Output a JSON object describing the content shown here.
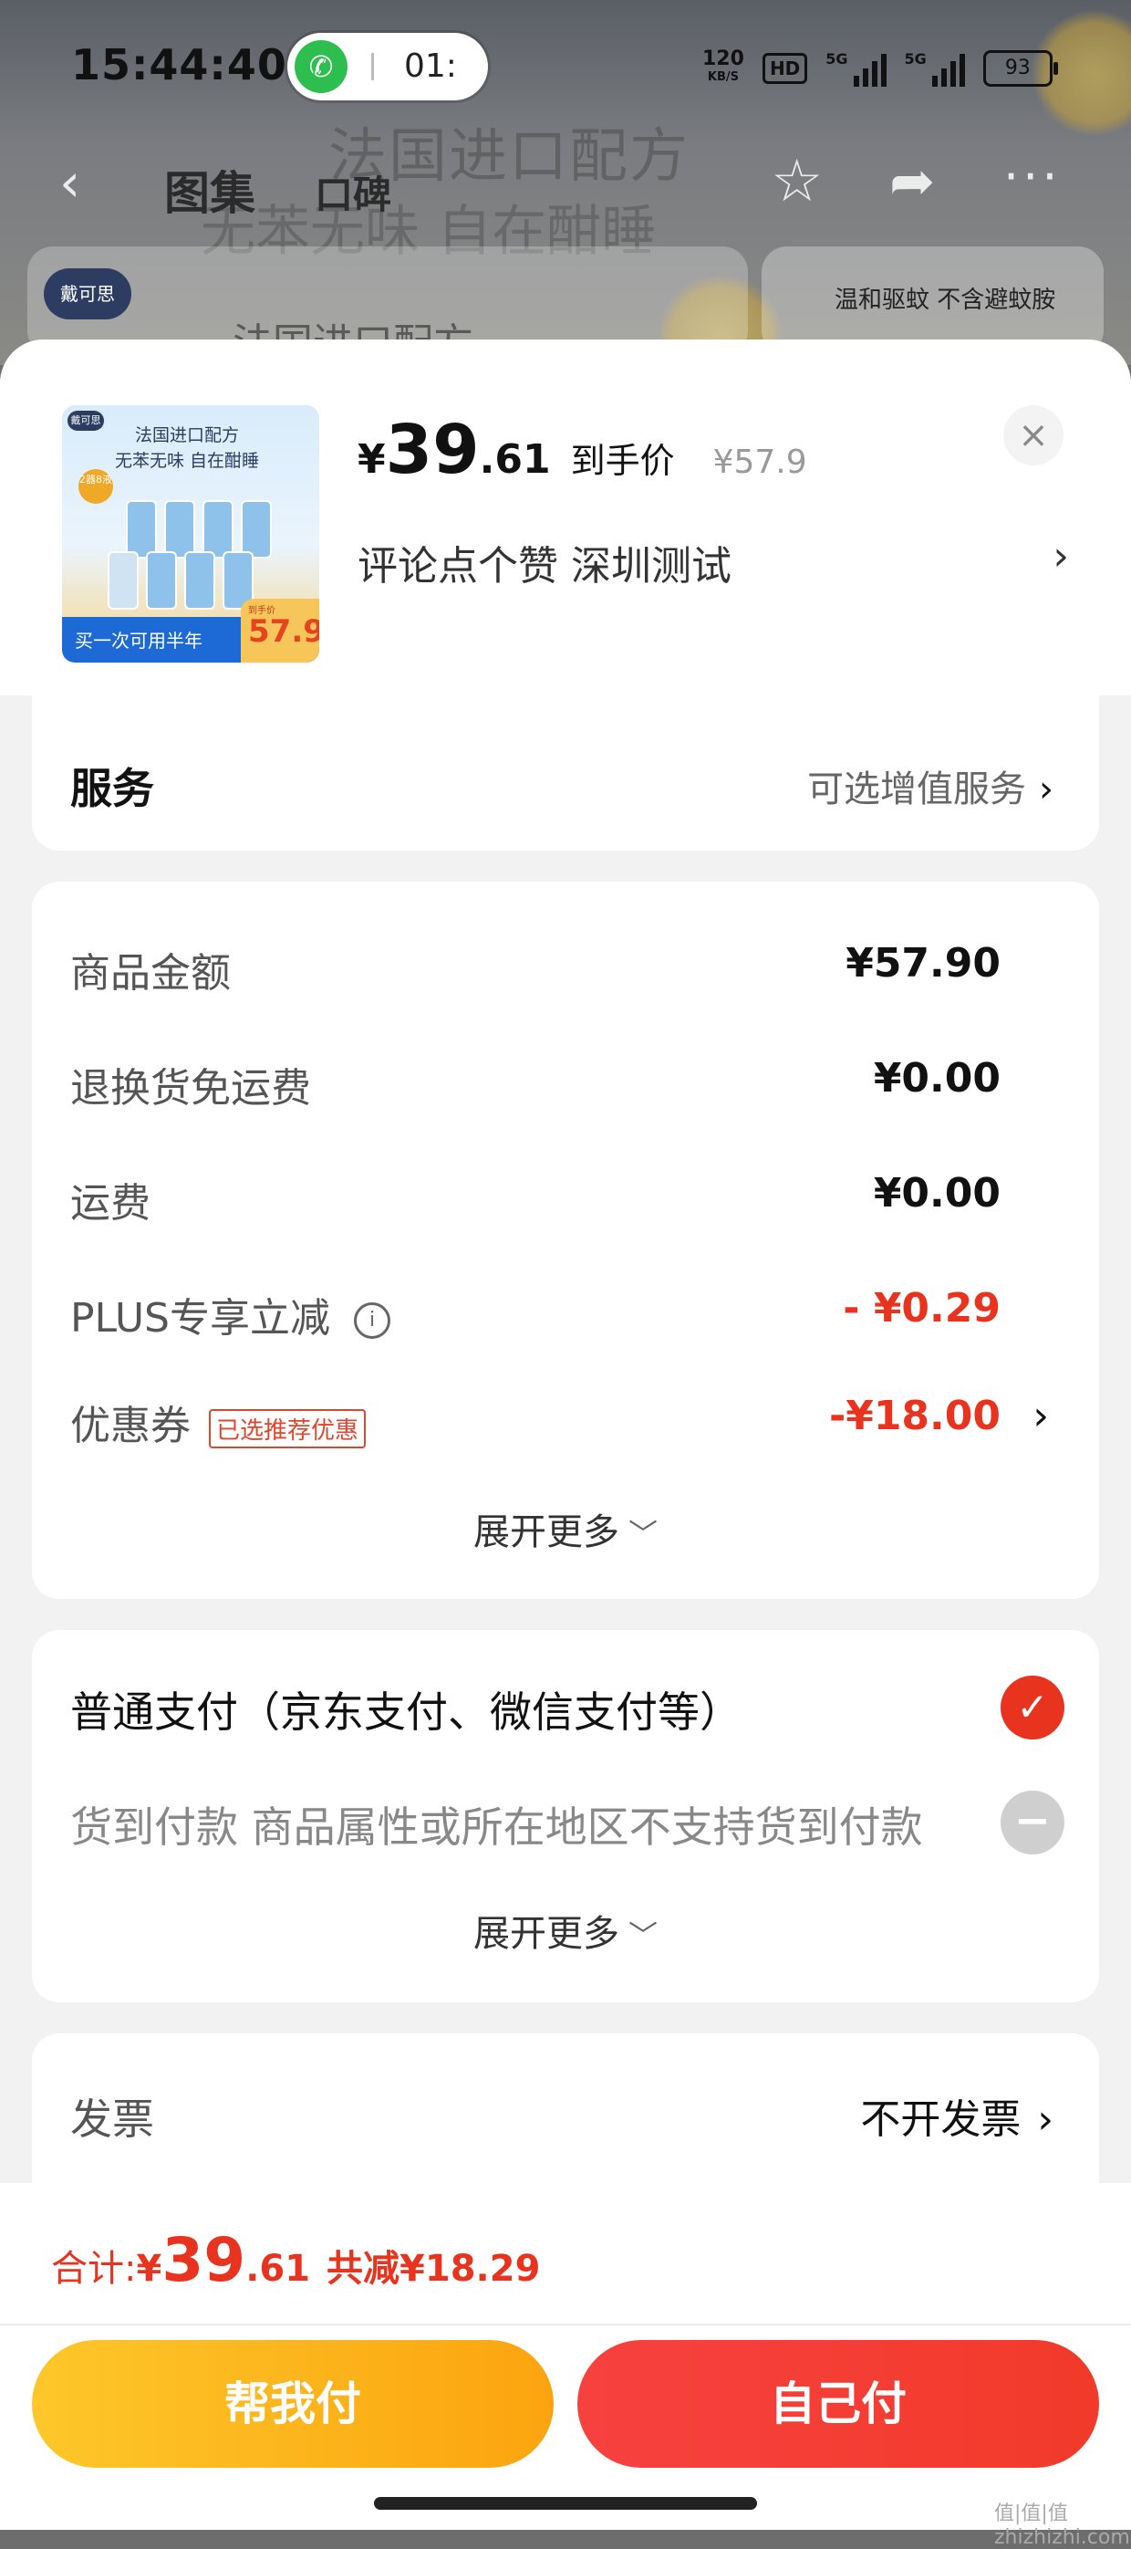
{
  "status_bar": {
    "time": "15:44:40",
    "call_timer": "01:",
    "net_speed_value": "120",
    "net_speed_unit": "KB/S",
    "hd": "HD",
    "sig1_label": "5G",
    "sig2_label": "5G",
    "battery": "93"
  },
  "nav": {
    "tab_gallery": "图集",
    "tab_reviews": "口碑"
  },
  "background": {
    "headline": "法国进口配方",
    "subhead": "无苯无味 自在酣睡",
    "brand": "戴可思",
    "subtitle": "法国进口配方",
    "card2_text": "温和驱蚊 不含避蚊胺"
  },
  "product": {
    "thumb": {
      "logo": "戴可思",
      "line1": "法国进口配方",
      "line2": "无苯无味 自在酣睡",
      "badge": "2器8液",
      "footer": "买一次可用半年",
      "price_label": "到手价",
      "price": "57.9"
    },
    "currency": "¥",
    "price_int": "39",
    "price_dec": ".61",
    "price_tag": "到手价",
    "original_price": "¥57.9",
    "close_icon": "×",
    "selection": "评论点个赞  深圳测试",
    "selection_chevron": "›"
  },
  "service": {
    "title": "服务",
    "option": "可选增值服务",
    "chevron": "›"
  },
  "fees": [
    {
      "label": "商品金额",
      "value": "¥57.90"
    },
    {
      "label": "退换货免运费",
      "value": "¥0.00"
    },
    {
      "label": "运费",
      "value": "¥0.00"
    },
    {
      "label": "PLUS专享立减",
      "value": "- ¥0.29"
    },
    {
      "label": "优惠券",
      "tag": "已选推荐优惠",
      "value": "-¥18.00"
    }
  ],
  "fees_expand": "展开更多",
  "payment": {
    "normal": "普通支付（京东支付、微信支付等）",
    "cod": "货到付款 商品属性或所在地区不支持货到付款",
    "expand": "展开更多"
  },
  "invoice": {
    "label": "发票",
    "value": "不开发票"
  },
  "footer": {
    "total_label": "合计:",
    "currency": "¥",
    "total_int": "39",
    "total_dec": ".61",
    "saved": "共减¥18.29",
    "help_pay": "帮我付",
    "self_pay": "自己付"
  },
  "watermark": "值|值|值 zhizhizhi.com",
  "colors": {
    "accent_red": "#e8341e",
    "button_yellow": "#fca40f",
    "button_red": "#f23a2a",
    "call_green": "#2dbe4f"
  }
}
